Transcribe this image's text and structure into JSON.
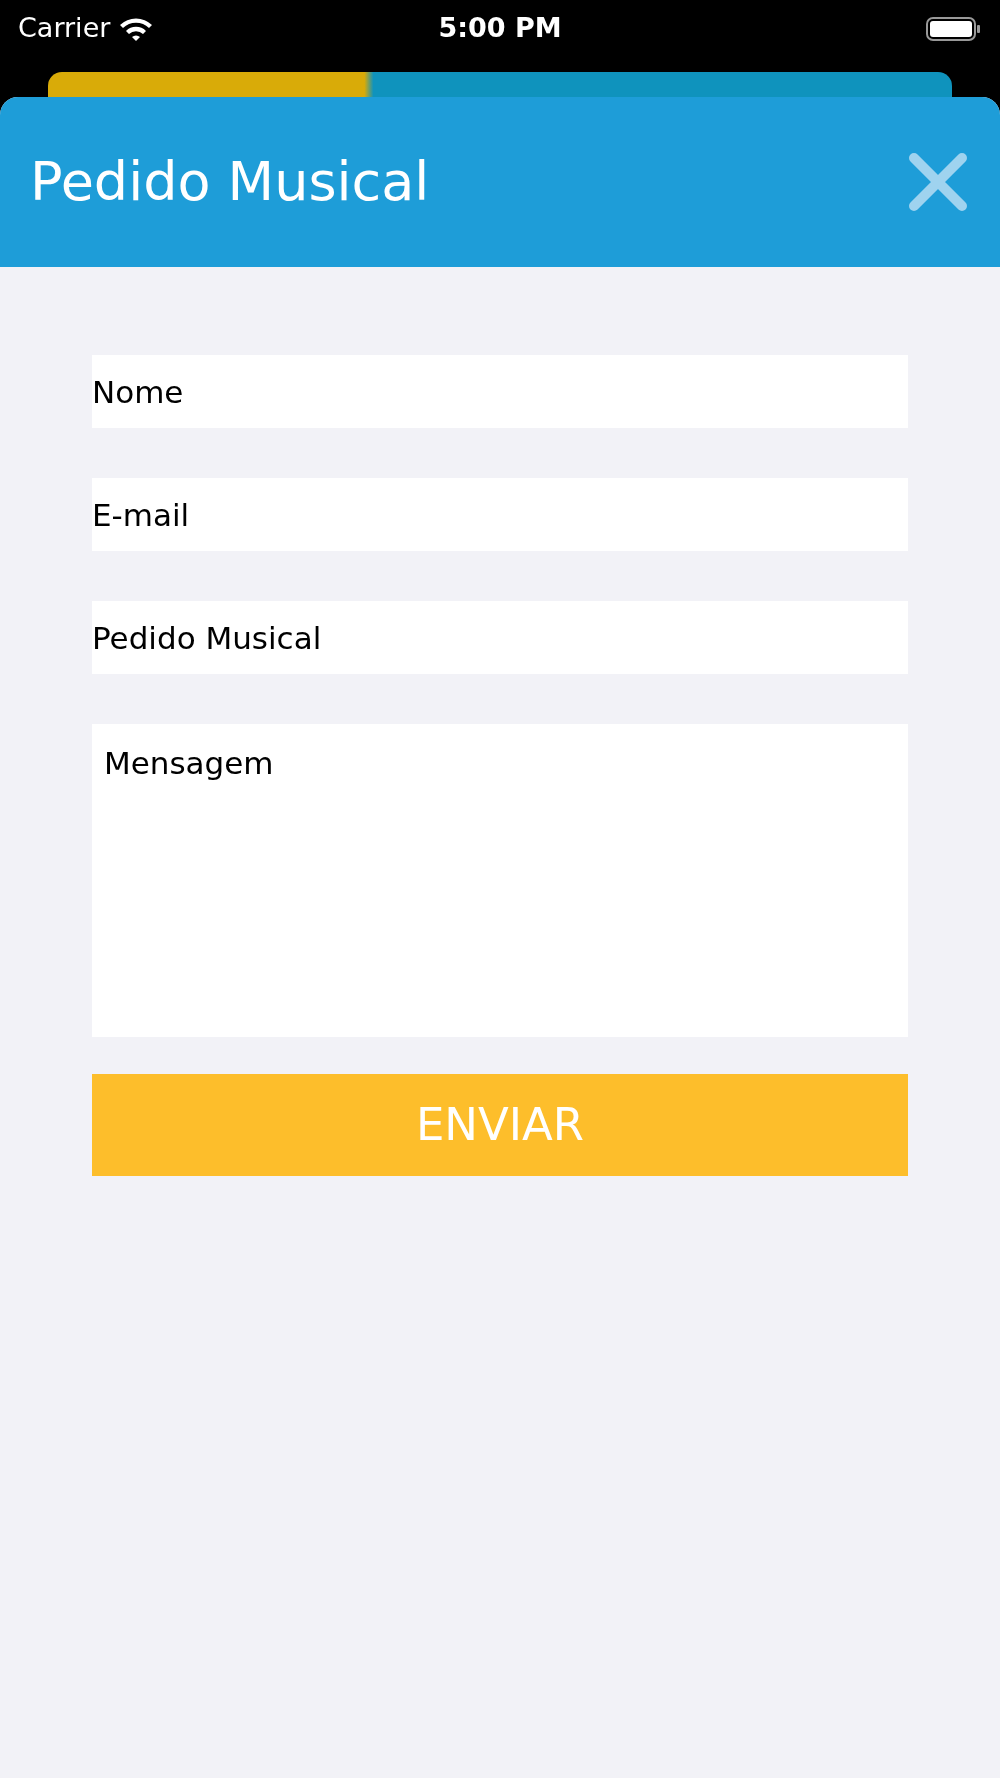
{
  "status_bar": {
    "carrier": "Carrier",
    "time": "5:00 PM"
  },
  "modal": {
    "title": "Pedido Musical"
  },
  "fields": [
    {
      "kind": "input",
      "placeholder": "Nome"
    },
    {
      "kind": "input",
      "placeholder": "E-mail"
    },
    {
      "kind": "input",
      "placeholder": "Pedido Musical"
    },
    {
      "kind": "textarea",
      "placeholder": "Mensagem"
    }
  ],
  "submit_button": "ENVIAR"
}
